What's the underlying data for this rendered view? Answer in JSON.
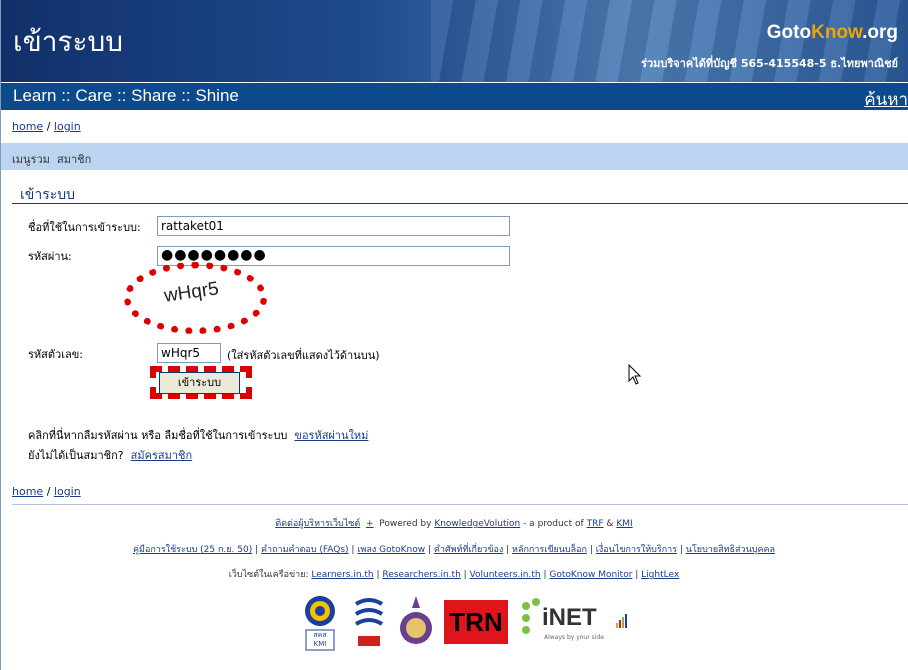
{
  "header": {
    "title": "เข้าระบบ",
    "logo_goto": "Goto",
    "logo_know": "Know",
    "logo_org": ".org",
    "donate": "ร่วมบริจาคได้ที่บัญชี 565-415548-5 ธ.ไทยพาณิชย์"
  },
  "tagbar": {
    "tagline": "Learn :: Care :: Share :: Shine",
    "search": "ค้นหา"
  },
  "breadcrumb": {
    "home": "home",
    "sep": "/",
    "login": "login"
  },
  "menu": {
    "main": "เมนูรวม",
    "member": "สมาชิก"
  },
  "form": {
    "section_title": "เข้าระบบ",
    "username_label": "ชื่อที่ใช้ในการเข้าระบบ:",
    "username_value": "rattaket01",
    "password_label": "รหัสผ่าน:",
    "password_value": "●●●●●●●●",
    "captcha_image_text": "wHqr5",
    "code_label": "รหัสตัวเลข:",
    "code_value": "wHqr5",
    "code_hint": "(ใส่รหัสตัวเลขที่แสดงไว้ด้านบน)",
    "submit": "เข้าระบบ"
  },
  "help": {
    "forgot_text": "คลิกที่นี่หากลืมรหัสผ่าน หรือ ลืมชื่อที่ใช้ในการเข้าระบบ",
    "forgot_link": "ขอรหัสผ่านใหม่",
    "notmember_text": "ยังไม่ได้เป็นสมาชิก?",
    "register_link": "สมัครสมาชิก"
  },
  "footer": {
    "contact_admin": "ติดต่อผู้บริหารเว็บไซต์",
    "plus": "+",
    "powered_by": "Powered by",
    "knowledgevolution": "KnowledgeVolution",
    "product_of": "- a product of",
    "trf": "TRF",
    "amp": "&",
    "kmi": "KMI",
    "links": [
      "คู่มือการใช้ระบบ (25 ก.ย. 50)",
      "คำถามคำตอบ (FAQs)",
      "เพลง GotoKnow",
      "คำศัพท์ที่เกี่ยวข้อง",
      "หลักการเขียนบล็อก",
      "เงื่อนไขการให้บริการ",
      "นโยบายสิทธิส่วนบุคคล"
    ],
    "network_label": "เว็บไซต์ในเครือข่าย:",
    "network_links": [
      "Learners.in.th",
      "Researchers.in.th",
      "Volunteers.in.th",
      "GotoKnow Monitor",
      "LightLex"
    ],
    "logo_kmi": "สคส KMI",
    "logo_trn": "TRN",
    "logo_inet": "iNET",
    "logo_inet_sub": "Always by your side"
  },
  "colors": {
    "header_bg": "#1d4b8e",
    "tagbar_bg": "#0c4a8c",
    "menubar_bg": "#bcd4f0",
    "highlight": "#dd0000"
  }
}
